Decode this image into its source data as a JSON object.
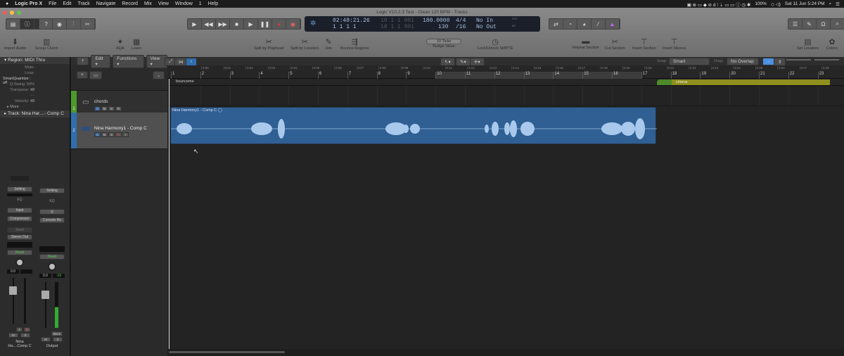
{
  "menubar": {
    "apple": "",
    "app": "Logic Pro X",
    "items": [
      "File",
      "Edit",
      "Track",
      "Navigate",
      "Record",
      "Mix",
      "View",
      "Window",
      "1",
      "Help"
    ],
    "battery": "100%",
    "datetime": "Sat 11 Jun  5:24 PM"
  },
  "window": {
    "title": "Logic V10.2.3 Test - Clean 120 BPM - Tracks"
  },
  "lcd": {
    "time": "02:48:21.26",
    "bars": "1  1  1     1",
    "left_locator": "10  1  1  001",
    "right_locator": "18  1  1  001",
    "tempo": "180.0000",
    "tempo2": "130",
    "sig": "4/4",
    "division": "/16",
    "in": "No In",
    "out": "No Out",
    "cpu": "CPU",
    "hd": "HD"
  },
  "toolbar": {
    "left": [
      {
        "label": "Import Audio",
        "icon": "download-icon"
      },
      {
        "label": "Group Clutch",
        "icon": "group-clutch-icon"
      },
      {
        "label": "AQA",
        "icon": "aqa-icon"
      },
      {
        "label": "Learn",
        "icon": "keyboard-icon"
      },
      {
        "label": "Split by Playhead",
        "icon": "scissors-icon"
      },
      {
        "label": "Split by Locators",
        "icon": "scissors-icon"
      },
      {
        "label": "Join",
        "icon": "glue-icon"
      },
      {
        "label": "Bounce Regions",
        "icon": "bounce-icon"
      }
    ],
    "nudge": {
      "value": "10 Ticks",
      "label": "Nudge Value"
    },
    "lock_smpte": "Lock/Unlock SMPTE",
    "right": [
      {
        "label": "Repeat Section"
      },
      {
        "label": "Cut Section"
      },
      {
        "label": "Insert Section"
      },
      {
        "label": "Insert Silence"
      },
      {
        "label": "Set Locators"
      },
      {
        "label": "Colors"
      }
    ]
  },
  "inspector": {
    "region_header": "Region: MIDI Thru",
    "rows": [
      {
        "label": "Mute:",
        "value": ""
      },
      {
        "label": "Loop:",
        "value": ""
      },
      {
        "label": "SmartQuantize",
        "value": "off"
      },
      {
        "label": "Q-Swing:",
        "value": "50%"
      },
      {
        "label": "Transpose:",
        "value": "±0"
      },
      {
        "label": "",
        "value": "- -"
      },
      {
        "label": "Velocity:",
        "value": "±0"
      }
    ],
    "more": "More",
    "track_header": "Track:  Nina Har....- Comp C"
  },
  "channel_strips": [
    {
      "setting": "Setting",
      "eq": "EQ",
      "input": "Input",
      "plugin": "Compressor",
      "send": "Send",
      "output": "Stereo Out",
      "automation": "Read",
      "volume": "0.0",
      "peak": "",
      "ir": [
        "I",
        "R"
      ],
      "ms": [
        "M",
        "S"
      ],
      "name": "Nina Ha....Comp C"
    },
    {
      "setting": "Setting",
      "eq": "EQ",
      "input": "",
      "plugin": "Console Re",
      "send": "",
      "output": "",
      "automation": "Read",
      "volume": "0.0",
      "peak": "-19",
      "ir": [
        "Bnce"
      ],
      "ms": [
        "M",
        "S"
      ],
      "name": "Output"
    }
  ],
  "tracks_header": {
    "edit": "Edit",
    "functions": "Functions",
    "view": "View"
  },
  "tracks": [
    {
      "number": "1",
      "name": "chords",
      "color": "#4c9a2a",
      "buttons": [
        "⏻",
        "M",
        "S",
        "R"
      ]
    },
    {
      "number": "2",
      "name": "Nina Harmony1 - Comp C",
      "color": "#2f6fae",
      "buttons": [
        "⏻",
        "M",
        "S",
        "R",
        "I"
      ]
    }
  ],
  "snap": {
    "label": "Snap:",
    "value": "Smart"
  },
  "drag": {
    "label": "Drag:",
    "value": "No Overlap"
  },
  "ruler": {
    "bars": [
      "1",
      "2",
      "3",
      "4",
      "5",
      "6",
      "7",
      "8",
      "9",
      "10",
      "11",
      "12",
      "13",
      "14",
      "15",
      "16",
      "17",
      "18",
      "19",
      "20",
      "21",
      "22",
      "23"
    ],
    "times": [
      "0:00",
      "0:01",
      "0:02",
      "0:03",
      "0:04",
      "0:05",
      "0:06",
      "0:07",
      "0:08",
      "0:09",
      "0:10",
      "0:11",
      "0:12",
      "0:13",
      "0:14",
      "0:15",
      "0:16",
      "0:17",
      "0:18",
      "0:19",
      "0:20",
      "0:21",
      "0:22",
      "0:23",
      "0:24",
      "0:25",
      "0:26",
      "0:27",
      "0:28"
    ]
  },
  "markers": [
    {
      "name": "bounceme"
    },
    {
      "name": "chorus",
      "color": "#8f8f1e"
    }
  ],
  "region": {
    "name": "Nina Harmony1 - Comp C",
    "color": "#2f5f93"
  },
  "colors": {
    "accent": "#4a90e2",
    "cycle": "#3a3a3a"
  }
}
